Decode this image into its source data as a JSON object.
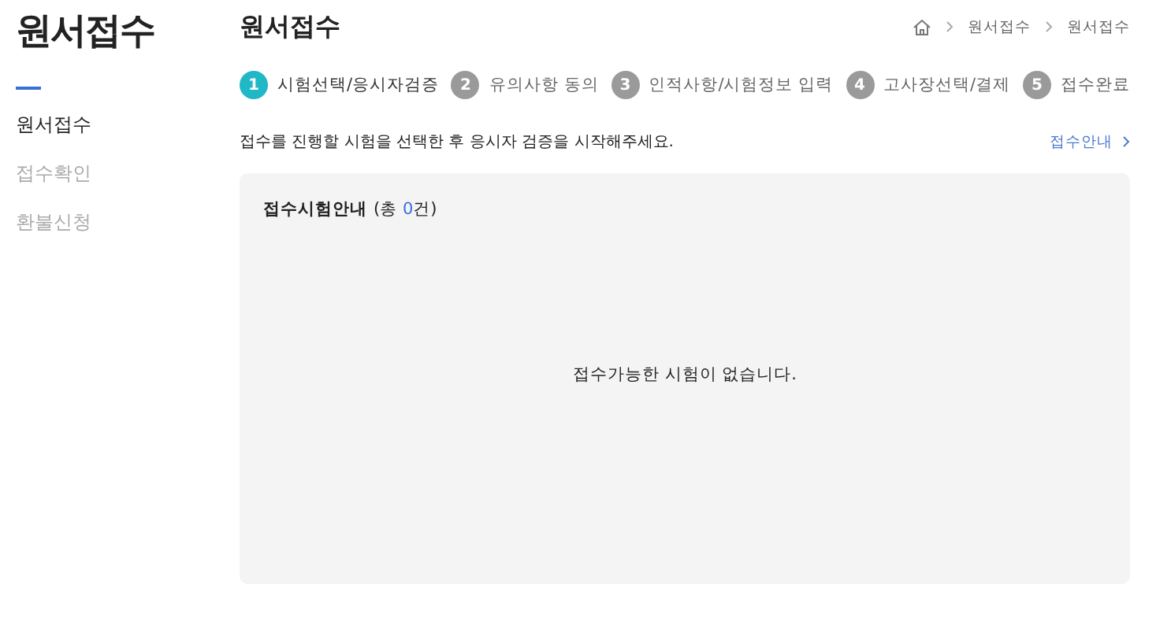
{
  "sidebar": {
    "title": "원서접수",
    "items": [
      {
        "label": "원서접수",
        "selected": true
      },
      {
        "label": "접수확인",
        "selected": false
      },
      {
        "label": "환불신청",
        "selected": false
      }
    ]
  },
  "page_title": "원서접수",
  "breadcrumb": [
    "원서접수",
    "원서접수"
  ],
  "steps": [
    {
      "number": "1",
      "label": "시험선택/응시자검증",
      "selected": true
    },
    {
      "number": "2",
      "label": "유의사항 동의",
      "selected": false
    },
    {
      "number": "3",
      "label": "인적사항/시험정보 입력",
      "selected": false
    },
    {
      "number": "4",
      "label": "고사장선택/결제",
      "selected": false
    },
    {
      "number": "5",
      "label": "접수완료",
      "selected": false
    }
  ],
  "instruction": "접수를 진행할 시험을 선택한 후 응시자 검증을 시작해주세요.",
  "guide_link": "접수안내",
  "panel": {
    "title": "접수시험안내",
    "count_prefix": "(총 ",
    "count": "0",
    "count_suffix": "건)",
    "empty_message": "접수가능한 시험이 없습니다."
  }
}
